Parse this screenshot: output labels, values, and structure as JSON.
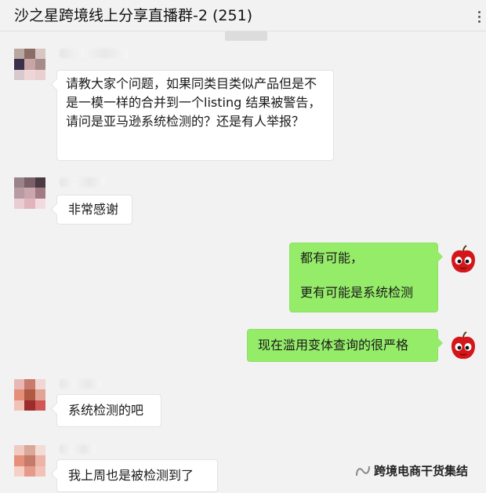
{
  "header": {
    "title": "沙之星跨境线上分享直播群-2 (251)",
    "time_chip": ""
  },
  "messages": [
    {
      "side": "left",
      "text": "请教大家个问题，如果同类目类似产品但是不是一模一样的合并到一个listing 结果被警告，请问是亚马逊系统检测的？还是有人举报？"
    },
    {
      "side": "left",
      "text": "非常感谢"
    },
    {
      "side": "right",
      "lines": [
        "都有可能，",
        "更有可能是系统检测"
      ]
    },
    {
      "side": "right",
      "text": "现在滥用变体查询的很严格"
    },
    {
      "side": "left",
      "text": "系统检测的吧"
    },
    {
      "side": "left",
      "text": "我上周也是被检测到了"
    }
  ],
  "watermark": {
    "text": "跨境电商干货集结",
    "icon": "wechat-channel-icon"
  },
  "colors": {
    "bubble_self": "#95ec69",
    "bubble_other": "#ffffff",
    "background": "#f2f2f2"
  }
}
